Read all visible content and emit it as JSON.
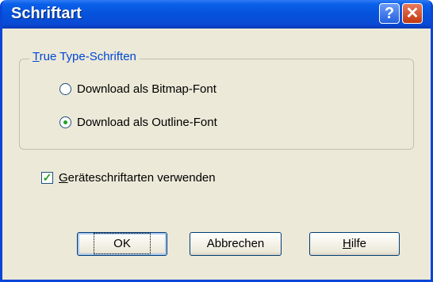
{
  "window": {
    "title": "Schriftart"
  },
  "titlebar_buttons": {
    "help": "?",
    "close": "✕"
  },
  "group": {
    "legend_accel": "T",
    "legend_rest": "rue Type-Schriften",
    "options": [
      {
        "label": "Download als Bitmap-Font",
        "selected": false
      },
      {
        "label": "Download als Outline-Font",
        "selected": true
      }
    ]
  },
  "checkbox": {
    "accel": "G",
    "label_rest": "eräteschriftarten verwenden",
    "checked": true,
    "check_glyph": "✓"
  },
  "buttons": {
    "ok": "OK",
    "cancel": "Abbrechen",
    "help_accel": "H",
    "help_rest": "ilfe"
  },
  "colors": {
    "titlebar": "#0552dc",
    "dialog_bg": "#ece9d8",
    "legend": "#0046d5",
    "check": "#21a121"
  }
}
